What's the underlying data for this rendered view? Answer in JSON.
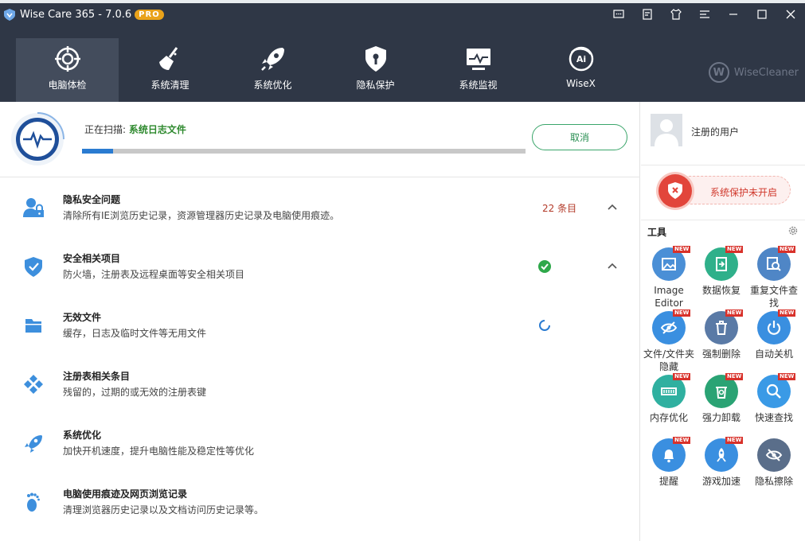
{
  "app": {
    "title": "Wise Care 365 - 7.0.6",
    "badge": "PRO",
    "brand": "WiseCleaner"
  },
  "nav": [
    {
      "label": "电脑体检",
      "icon": "crosshair-icon",
      "active": true
    },
    {
      "label": "系统清理",
      "icon": "broom-icon",
      "active": false
    },
    {
      "label": "系统优化",
      "icon": "rocket-icon",
      "active": false
    },
    {
      "label": "隐私保护",
      "icon": "lock-shield-icon",
      "active": false
    },
    {
      "label": "系统监视",
      "icon": "monitor-icon",
      "active": false
    },
    {
      "label": "WiseX",
      "icon": "wisex-ai-icon",
      "active": false
    }
  ],
  "scan": {
    "prefix": "正在扫描:",
    "target": "系统日志文件",
    "progress": 0.07,
    "cancel_label": "取消"
  },
  "items": [
    {
      "title": "隐私安全问题",
      "desc": "清除所有IE浏览历史记录，资源管理器历史记录及电脑使用痕迹。",
      "count": "22 条目",
      "status": "count",
      "expand": true,
      "icon": "user-lock-icon"
    },
    {
      "title": "安全相关项目",
      "desc": "防火墙，注册表及远程桌面等安全相关项目",
      "count": "",
      "status": "ok",
      "expand": true,
      "icon": "shield-check-icon"
    },
    {
      "title": "无效文件",
      "desc": "缓存，日志及临时文件等无用文件",
      "count": "",
      "status": "loading",
      "expand": false,
      "icon": "folder-icon"
    },
    {
      "title": "注册表相关条目",
      "desc": "残留的，过期的或无效的注册表键",
      "count": "",
      "status": "",
      "expand": false,
      "icon": "registry-diamond-icon"
    },
    {
      "title": "系统优化",
      "desc": "加快开机速度，提升电脑性能及稳定性等优化",
      "count": "",
      "status": "",
      "expand": false,
      "icon": "rocket-icon"
    },
    {
      "title": "电脑使用痕迹及网页浏览记录",
      "desc": "清理浏览器历史记录以及文档访问历史记录等。",
      "count": "",
      "status": "",
      "expand": false,
      "icon": "footprint-icon"
    }
  ],
  "user": {
    "name": "注册的用户"
  },
  "protection": {
    "label": "系统保护未开启"
  },
  "tools": {
    "title": "工具",
    "new_badge": "NEW",
    "list": [
      {
        "label": "Image Editor",
        "color": "#4a8fd6",
        "icon": "image-editor-icon",
        "new": true
      },
      {
        "label": "数据恢复",
        "color": "#2fb08a",
        "icon": "data-recovery-icon",
        "new": true
      },
      {
        "label": "重复文件查找",
        "color": "#4f86c6",
        "icon": "duplicate-finder-icon",
        "new": true
      },
      {
        "label": "文件/文件夹隐藏",
        "color": "#3a8fe0",
        "icon": "hide-eye-icon",
        "new": true
      },
      {
        "label": "强制删除",
        "color": "#5a7aa6",
        "icon": "trash-icon",
        "new": true
      },
      {
        "label": "自动关机",
        "color": "#3a8fe0",
        "icon": "power-icon",
        "new": true
      },
      {
        "label": "内存优化",
        "color": "#2fb0a0",
        "icon": "memory-icon",
        "new": true
      },
      {
        "label": "强力卸载",
        "color": "#2aa374",
        "icon": "uninstall-icon",
        "new": true
      },
      {
        "label": "快速查找",
        "color": "#3a9ae6",
        "icon": "search-icon",
        "new": true
      },
      {
        "label": "提醒",
        "color": "#3a8fe0",
        "icon": "bell-icon",
        "new": true
      },
      {
        "label": "游戏加速",
        "color": "#3a8fe0",
        "icon": "game-rocket-icon",
        "new": true
      },
      {
        "label": "隐私擦除",
        "color": "#5a6e8a",
        "icon": "privacy-eraser-icon",
        "new": false
      }
    ]
  },
  "colors": {
    "header": "#2f3746",
    "accent_green": "#2a8f53",
    "warning_red": "#d0382c",
    "progress_blue": "#2a7bd1"
  }
}
